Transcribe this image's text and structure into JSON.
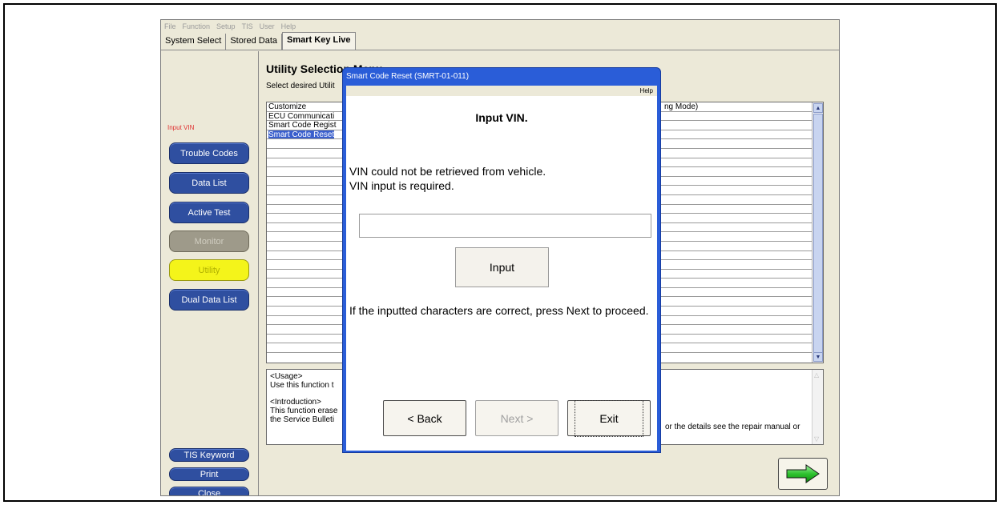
{
  "menubar": {
    "items": [
      "File",
      "Function",
      "Setup",
      "TIS",
      "User",
      "Help"
    ]
  },
  "tabs": [
    "System Select",
    "Stored Data",
    "Smart Key Live"
  ],
  "left_panel": {
    "input_vin_label": "Input VIN",
    "buttons": {
      "trouble_codes": "Trouble Codes",
      "data_list": "Data List",
      "active_test": "Active Test",
      "monitor": "Monitor",
      "utility": "Utility",
      "dual_data_list": "Dual Data List",
      "tis_keyword": "TIS Keyword",
      "print": "Print",
      "close": "Close"
    }
  },
  "main": {
    "title": "Utility Selection Menu",
    "subtitle": "Select desired Utilit",
    "list_items": [
      "Customize",
      "ECU Communicati",
      "Smart Code Regist",
      "Smart Code Reset"
    ],
    "list_col2_first": "ng Mode)",
    "usage": {
      "usage_heading": "<Usage>",
      "usage_text": "Use this function t",
      "intro_heading": "<Introduction>",
      "intro_line1": "This function erase",
      "intro_line2": "the Service Bulleti",
      "right_text": "or the details see the repair manual or"
    }
  },
  "dialog": {
    "title": "Smart Code Reset (SMRT-01-011)",
    "help": "Help",
    "heading": "Input VIN.",
    "message_line1": "VIN could not be retrieved from vehicle.",
    "message_line2": "VIN input is required.",
    "vin_value": "",
    "input_button": "Input",
    "note": "If the inputted characters are correct, press Next to proceed.",
    "back_button": "< Back",
    "next_button": "Next >",
    "exit_button": "Exit"
  },
  "colors": {
    "nav_button": "#2f4fa0",
    "utility_active": "#f4f41a",
    "dialog_titlebar": "#2a5dd8",
    "selected_row": "#3a5fcd"
  }
}
